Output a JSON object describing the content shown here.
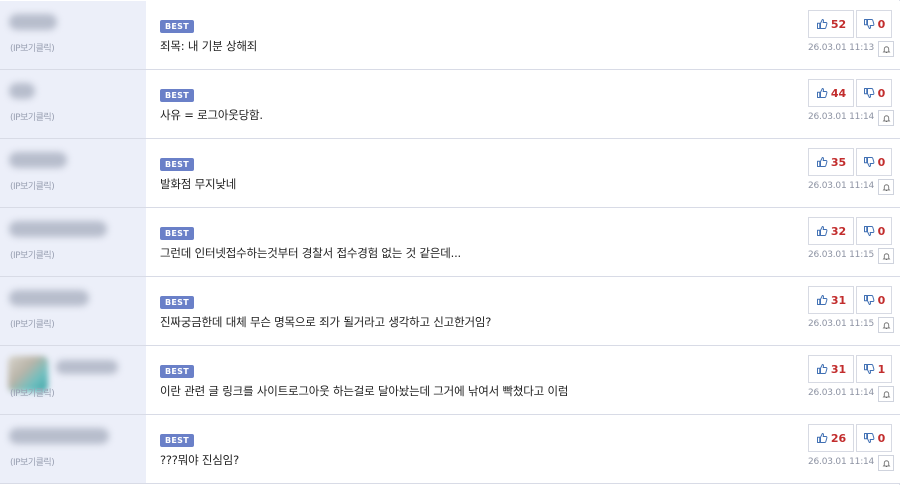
{
  "colors": {
    "badge": "#6a80c8",
    "author_bg": "#eceff9",
    "vote_count": "#c22d2d",
    "thumb_icon": "#3f6fb3"
  },
  "comments": [
    {
      "ip_label": "(IP보기클릭)",
      "badge": "BEST",
      "text": "죄목: 내 기분 상해죄",
      "up": "52",
      "down": "0",
      "date": "26.03.01 11:13",
      "has_avatar": false
    },
    {
      "ip_label": "(IP보기클릭)",
      "badge": "BEST",
      "text": "사유 = 로그아웃당함.",
      "up": "44",
      "down": "0",
      "date": "26.03.01 11:14",
      "has_avatar": false
    },
    {
      "ip_label": "(IP보기클릭)",
      "badge": "BEST",
      "text": "발화점 무지낮네",
      "up": "35",
      "down": "0",
      "date": "26.03.01 11:14",
      "has_avatar": false
    },
    {
      "ip_label": "(IP보기클릭)",
      "badge": "BEST",
      "text": "그런데 인터넷접수하는것부터 경찰서 접수경험 없는 것 같은데...",
      "up": "32",
      "down": "0",
      "date": "26.03.01 11:15",
      "has_avatar": false
    },
    {
      "ip_label": "(IP보기클릭)",
      "badge": "BEST",
      "text": "진짜궁금한데 대체 무슨 명목으로 죄가 될거라고 생각하고 신고한거임?",
      "up": "31",
      "down": "0",
      "date": "26.03.01 11:15",
      "has_avatar": false
    },
    {
      "ip_label": "(IP보기클릭)",
      "badge": "BEST",
      "text": "이란 관련 글 링크를 사이트로그아웃 하는걸로 달아놨는데 그거에 낚여서 빡쳤다고 이럼",
      "up": "31",
      "down": "1",
      "date": "26.03.01 11:14",
      "has_avatar": true
    },
    {
      "ip_label": "(IP보기클릭)",
      "badge": "BEST",
      "text": "???뭐야 진심임?",
      "up": "26",
      "down": "0",
      "date": "26.03.01 11:14",
      "has_avatar": false
    }
  ]
}
